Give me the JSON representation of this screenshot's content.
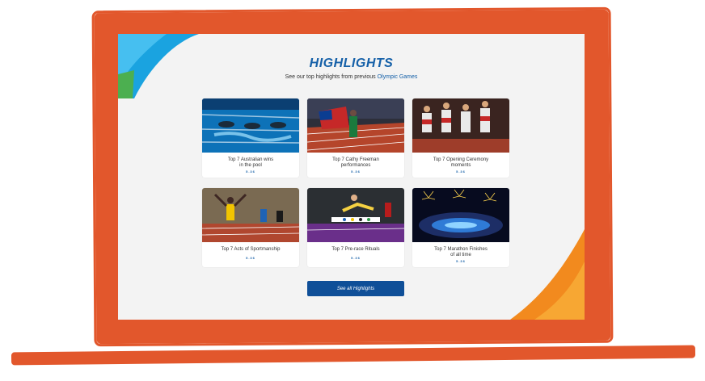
{
  "header": {
    "title": "HIGHLIGHTS",
    "subtitle_prefix": "See our top highlights from previous ",
    "subtitle_link": "Olympic Games"
  },
  "cards": [
    {
      "title_line1": "Top 7 Australian wins",
      "title_line2": "in the pool",
      "rating": "5.36"
    },
    {
      "title_line1": "Top 7 Cathy Freeman",
      "title_line2": "performances",
      "rating": "5.36"
    },
    {
      "title_line1": "Top 7 Opening Ceremony",
      "title_line2": "moments",
      "rating": "5.36"
    },
    {
      "title_line1": "Top 7 Acts of Sportmanship",
      "title_line2": "",
      "rating": "5.36"
    },
    {
      "title_line1": "Top 7 Pre-race Rituals",
      "title_line2": "",
      "rating": "5.36"
    },
    {
      "title_line1": "Top 7 Marathon Finishes",
      "title_line2": "of all time",
      "rating": "5.36"
    }
  ],
  "cta": {
    "label": "See all Highlights"
  },
  "colors": {
    "accent": "#1560a8",
    "button": "#0f4f98",
    "frame": "#e2572c"
  }
}
